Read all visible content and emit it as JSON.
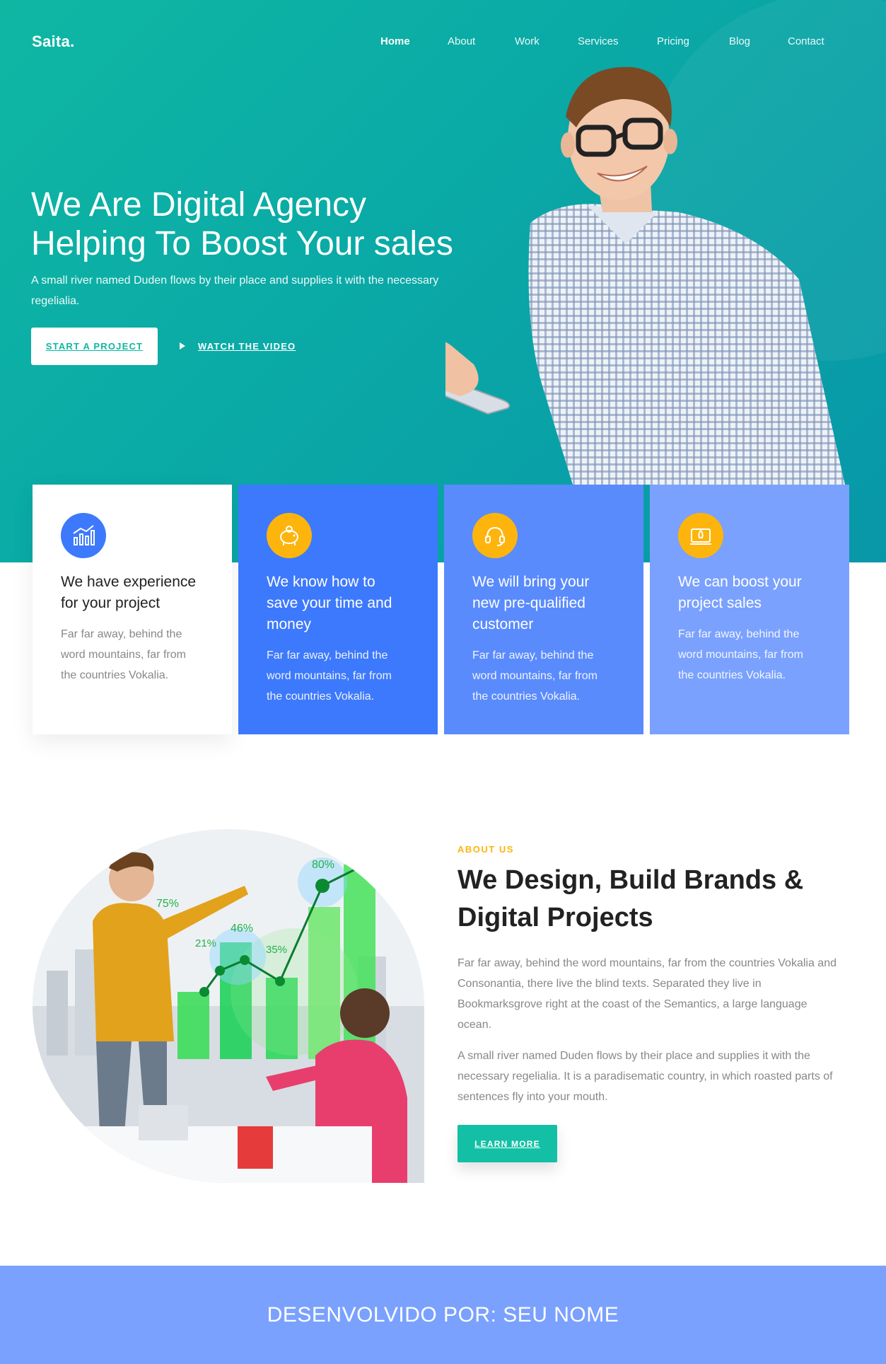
{
  "brand": "Saita.",
  "nav": {
    "items": [
      "Home",
      "About",
      "Work",
      "Services",
      "Pricing",
      "Blog",
      "Contact"
    ],
    "active": "Home"
  },
  "hero": {
    "title_line1": "We Are Digital Agency",
    "title_line2": "Helping To Boost Your sales",
    "subtitle": "A small river named Duden flows by their place and supplies it with the necessary regelialia.",
    "start_button": "START A PROJECT",
    "video_button": "WATCH THE VIDEO"
  },
  "cards": [
    {
      "icon": "chart-icon",
      "title": "We have experience for your project",
      "text": "Far far away, behind the word mountains, far from the countries Vokalia."
    },
    {
      "icon": "piggy-bank-icon",
      "title": "We know how to save your time and money",
      "text": "Far far away, behind the word mountains, far from the countries Vokalia."
    },
    {
      "icon": "headset-icon",
      "title": "We will bring your new pre-qualified customer",
      "text": "Far far away, behind the word mountains, far from the countries Vokalia."
    },
    {
      "icon": "rocket-icon",
      "title": "We can boost your project sales",
      "text": "Far far away, behind the word mountains, far from the countries Vokalia."
    }
  ],
  "about": {
    "tag": "ABOUT US",
    "title": "We Design, Build Brands & Digital Projects",
    "paragraph1": "Far far away, behind the word mountains, far from the countries Vokalia and Consonantia, there live the blind texts. Separated they live in Bookmarksgrove right at the coast of the Semantics, a large language ocean.",
    "paragraph2": "A small river named Duden flows by their place and supplies it with the necessary regelialia. It is a paradisematic country, in which roasted parts of sentences fly into your mouth.",
    "button": "LEARN MORE",
    "image_chart_labels": [
      "75%",
      "21%",
      "46%",
      "35%",
      "80%"
    ]
  },
  "footer": {
    "text": "DESENVOLVIDO POR: SEU NOME"
  },
  "colors": {
    "teal": "#0fb7a3",
    "blue": "#3d79fc",
    "blue2": "#5a8bfd",
    "blue3": "#7aa1fe",
    "yellow": "#fdb50d"
  }
}
